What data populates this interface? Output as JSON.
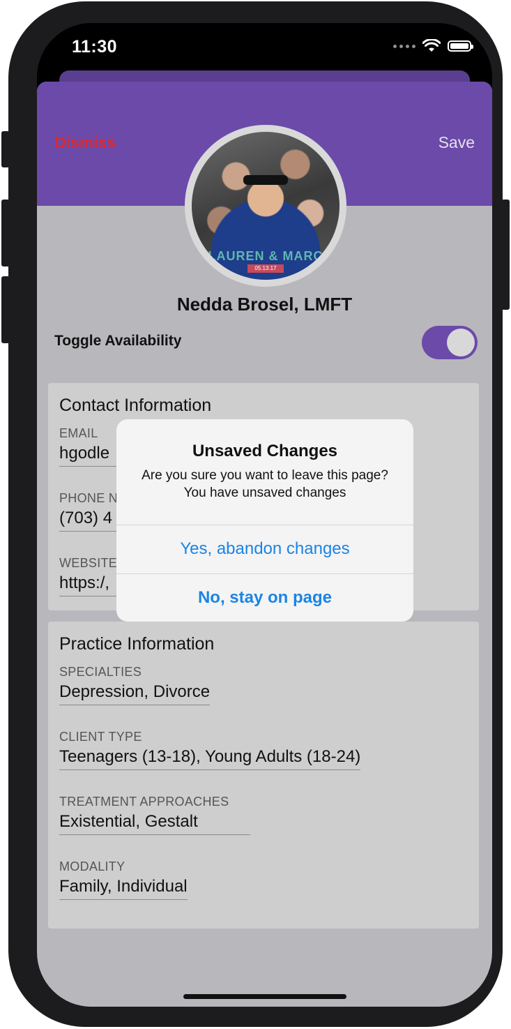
{
  "status_bar": {
    "time": "11:30"
  },
  "header": {
    "dismiss_label": "Dismiss",
    "save_label": "Save"
  },
  "avatar": {
    "photo_text": "LAUREN & MARC",
    "photo_date": "05.13.17"
  },
  "profile": {
    "name": "Nedda Brosel, LMFT",
    "toggle_label": "Toggle Availability",
    "available": true
  },
  "contact": {
    "title": "Contact Information",
    "fields": [
      {
        "label": "EMAIL",
        "value": "hgodle"
      },
      {
        "label": "PHONE N",
        "value": "(703) 4"
      },
      {
        "label": "WEBSITE",
        "value": "https:/,"
      }
    ]
  },
  "practice": {
    "title": "Practice Information",
    "fields": [
      {
        "label": "SPECIALTIES",
        "value": "Depression, Divorce"
      },
      {
        "label": "CLIENT TYPE",
        "value": "Teenagers (13-18), Young Adults (18-24)"
      },
      {
        "label": "TREATMENT APPROACHES",
        "value": "Existential, Gestalt"
      },
      {
        "label": "MODALITY",
        "value": "Family, Individual"
      }
    ]
  },
  "alert": {
    "title": "Unsaved Changes",
    "message": "Are you sure you want to leave this page? You have unsaved changes",
    "confirm_label": "Yes, abandon changes",
    "cancel_label": "No, stay on page"
  },
  "colors": {
    "accent": "#6b4aa9",
    "destructive": "#e3272a",
    "link": "#1a84e6"
  }
}
